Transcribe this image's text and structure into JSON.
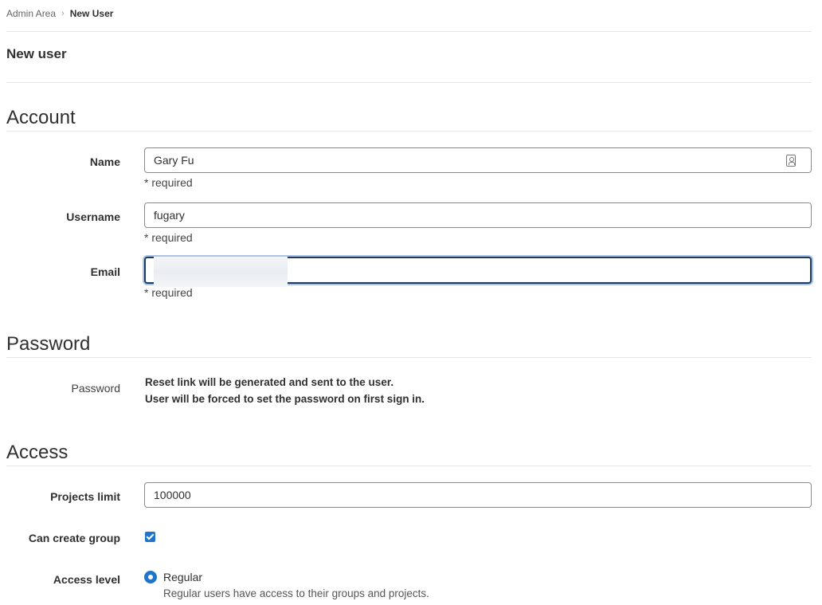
{
  "breadcrumb": {
    "parent": "Admin Area",
    "separator": "›",
    "current": "New User"
  },
  "page_title": "New user",
  "sections": {
    "account": "Account",
    "password": "Password",
    "access": "Access"
  },
  "account": {
    "name_label": "Name",
    "name_value": "Gary Fu",
    "name_help": "* required",
    "username_label": "Username",
    "username_value": "fugary",
    "username_help": "* required",
    "email_label": "Email",
    "email_help": "* required"
  },
  "password": {
    "label": "Password",
    "line1": "Reset link will be generated and sent to the user.",
    "line2": "User will be forced to set the password on first sign in."
  },
  "access": {
    "projects_limit_label": "Projects limit",
    "projects_limit_value": "100000",
    "can_create_group_label": "Can create group",
    "can_create_group_checked": true,
    "access_level_label": "Access level",
    "access_level_option": "Regular",
    "access_level_help": "Regular users have access to their groups and projects."
  },
  "colors": {
    "accent": "#1f75cb",
    "focus_ring": "#a9c4e6"
  },
  "icons": {
    "name_field_icon": "contact-card-icon",
    "breadcrumb_separator": "chevron-right-icon"
  }
}
